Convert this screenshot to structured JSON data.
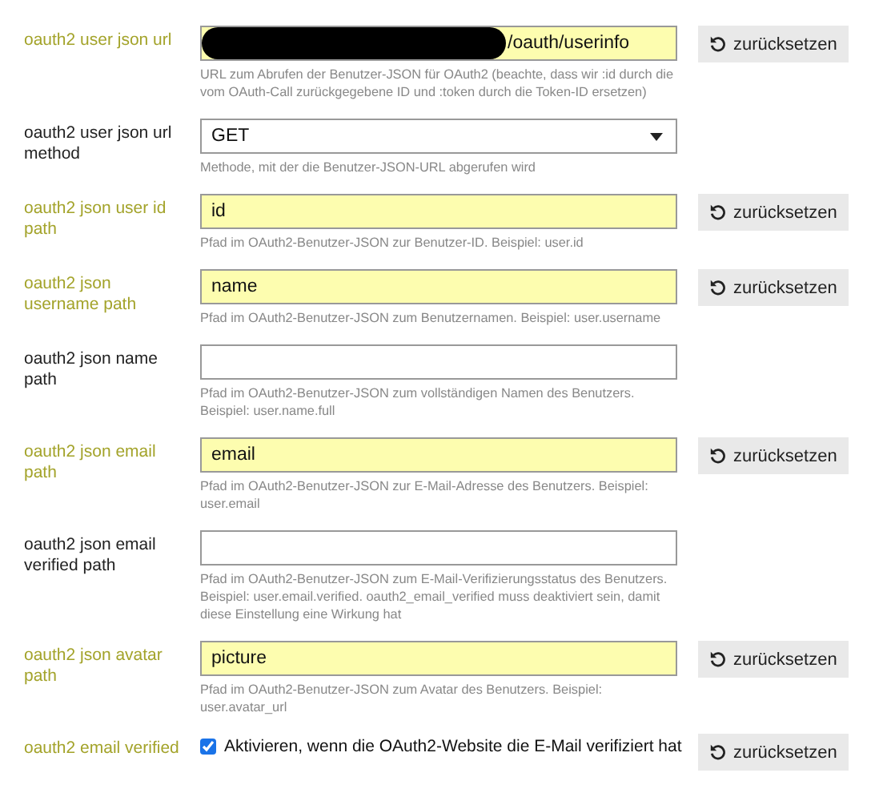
{
  "settings": [
    {
      "kind": "text",
      "label": "oauth2 user json url",
      "changed": true,
      "redacted": true,
      "value": "/oauth/userinfo",
      "description": "URL zum Abrufen der Benutzer-JSON für OAuth2 (beachte, dass wir :id durch die vom OAuth-Call zurückgegebene ID und :token durch die Token-ID ersetzen)",
      "reset": "zurücksetzen"
    },
    {
      "kind": "select",
      "label": "oauth2 user json url method",
      "changed": false,
      "value": "GET",
      "description": "Methode, mit der die Benutzer-JSON-URL abgerufen wird"
    },
    {
      "kind": "text",
      "label": "oauth2 json user id path",
      "changed": true,
      "value": "id",
      "description": "Pfad im OAuth2-Benutzer-JSON zur Benutzer-ID. Beispiel: user.id",
      "reset": "zurücksetzen"
    },
    {
      "kind": "text",
      "label": "oauth2 json username path",
      "changed": true,
      "value": "name",
      "description": "Pfad im OAuth2-Benutzer-JSON zum Benutzernamen. Beispiel: user.username",
      "reset": "zurücksetzen"
    },
    {
      "kind": "text",
      "label": "oauth2 json name path",
      "changed": false,
      "description": "Pfad im OAuth2-Benutzer-JSON zum vollständigen Namen des Benutzers. Beispiel: user.name.full"
    },
    {
      "kind": "text",
      "label": "oauth2 json email path",
      "changed": true,
      "value": "email",
      "description": "Pfad im OAuth2-Benutzer-JSON zur E-Mail-Adresse des Benutzers. Beispiel: user.email",
      "reset": "zurücksetzen"
    },
    {
      "kind": "text",
      "label": "oauth2 json email verified path",
      "changed": false,
      "description": "Pfad im OAuth2-Benutzer-JSON zum E-Mail-Verifizierungsstatus des Benutzers. Beispiel: user.email.verified. oauth2_email_verified muss deaktiviert sein, damit diese Einstellung eine Wirkung hat"
    },
    {
      "kind": "text",
      "label": "oauth2 json avatar path",
      "changed": true,
      "value": "picture",
      "description": "Pfad im OAuth2-Benutzer-JSON zum Avatar des Benutzers. Beispiel: user.avatar_url",
      "reset": "zurücksetzen"
    },
    {
      "kind": "checkbox",
      "label": "oauth2 email verified",
      "changed": true,
      "checked": true,
      "text": "Aktivieren, wenn die OAuth2-Website die E-Mail verifiziert hat",
      "reset": "zurücksetzen"
    }
  ]
}
